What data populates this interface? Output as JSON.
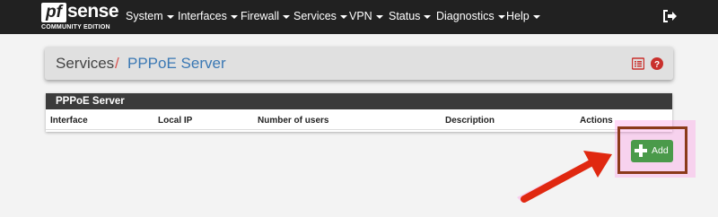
{
  "brand": {
    "logo_mark": "pf",
    "logo_word": "sense",
    "edition": "COMMUNITY EDITION"
  },
  "nav": {
    "items": [
      {
        "label": "System"
      },
      {
        "label": "Interfaces"
      },
      {
        "label": "Firewall"
      },
      {
        "label": "Services"
      },
      {
        "label": "VPN"
      },
      {
        "label": "Status"
      },
      {
        "label": "Diagnostics"
      },
      {
        "label": "Help"
      }
    ],
    "logout_icon": "sign-out-icon"
  },
  "breadcrumb": {
    "parent": "Services",
    "separator": "/",
    "current": "PPPoE Server",
    "icons": [
      "list-icon",
      "help-icon"
    ]
  },
  "table": {
    "title": "PPPoE Server",
    "columns": [
      "Interface",
      "Local IP",
      "Number of users",
      "Description",
      "Actions"
    ]
  },
  "actions": {
    "add_label": "Add",
    "add_icon": "plus-icon"
  },
  "colors": {
    "navbar": "#212121",
    "accent_link": "#3a78b4",
    "danger": "#d9534f",
    "success": "#4a9a4a",
    "annotation": "#8b3a1a",
    "arrow": "#e02810"
  }
}
